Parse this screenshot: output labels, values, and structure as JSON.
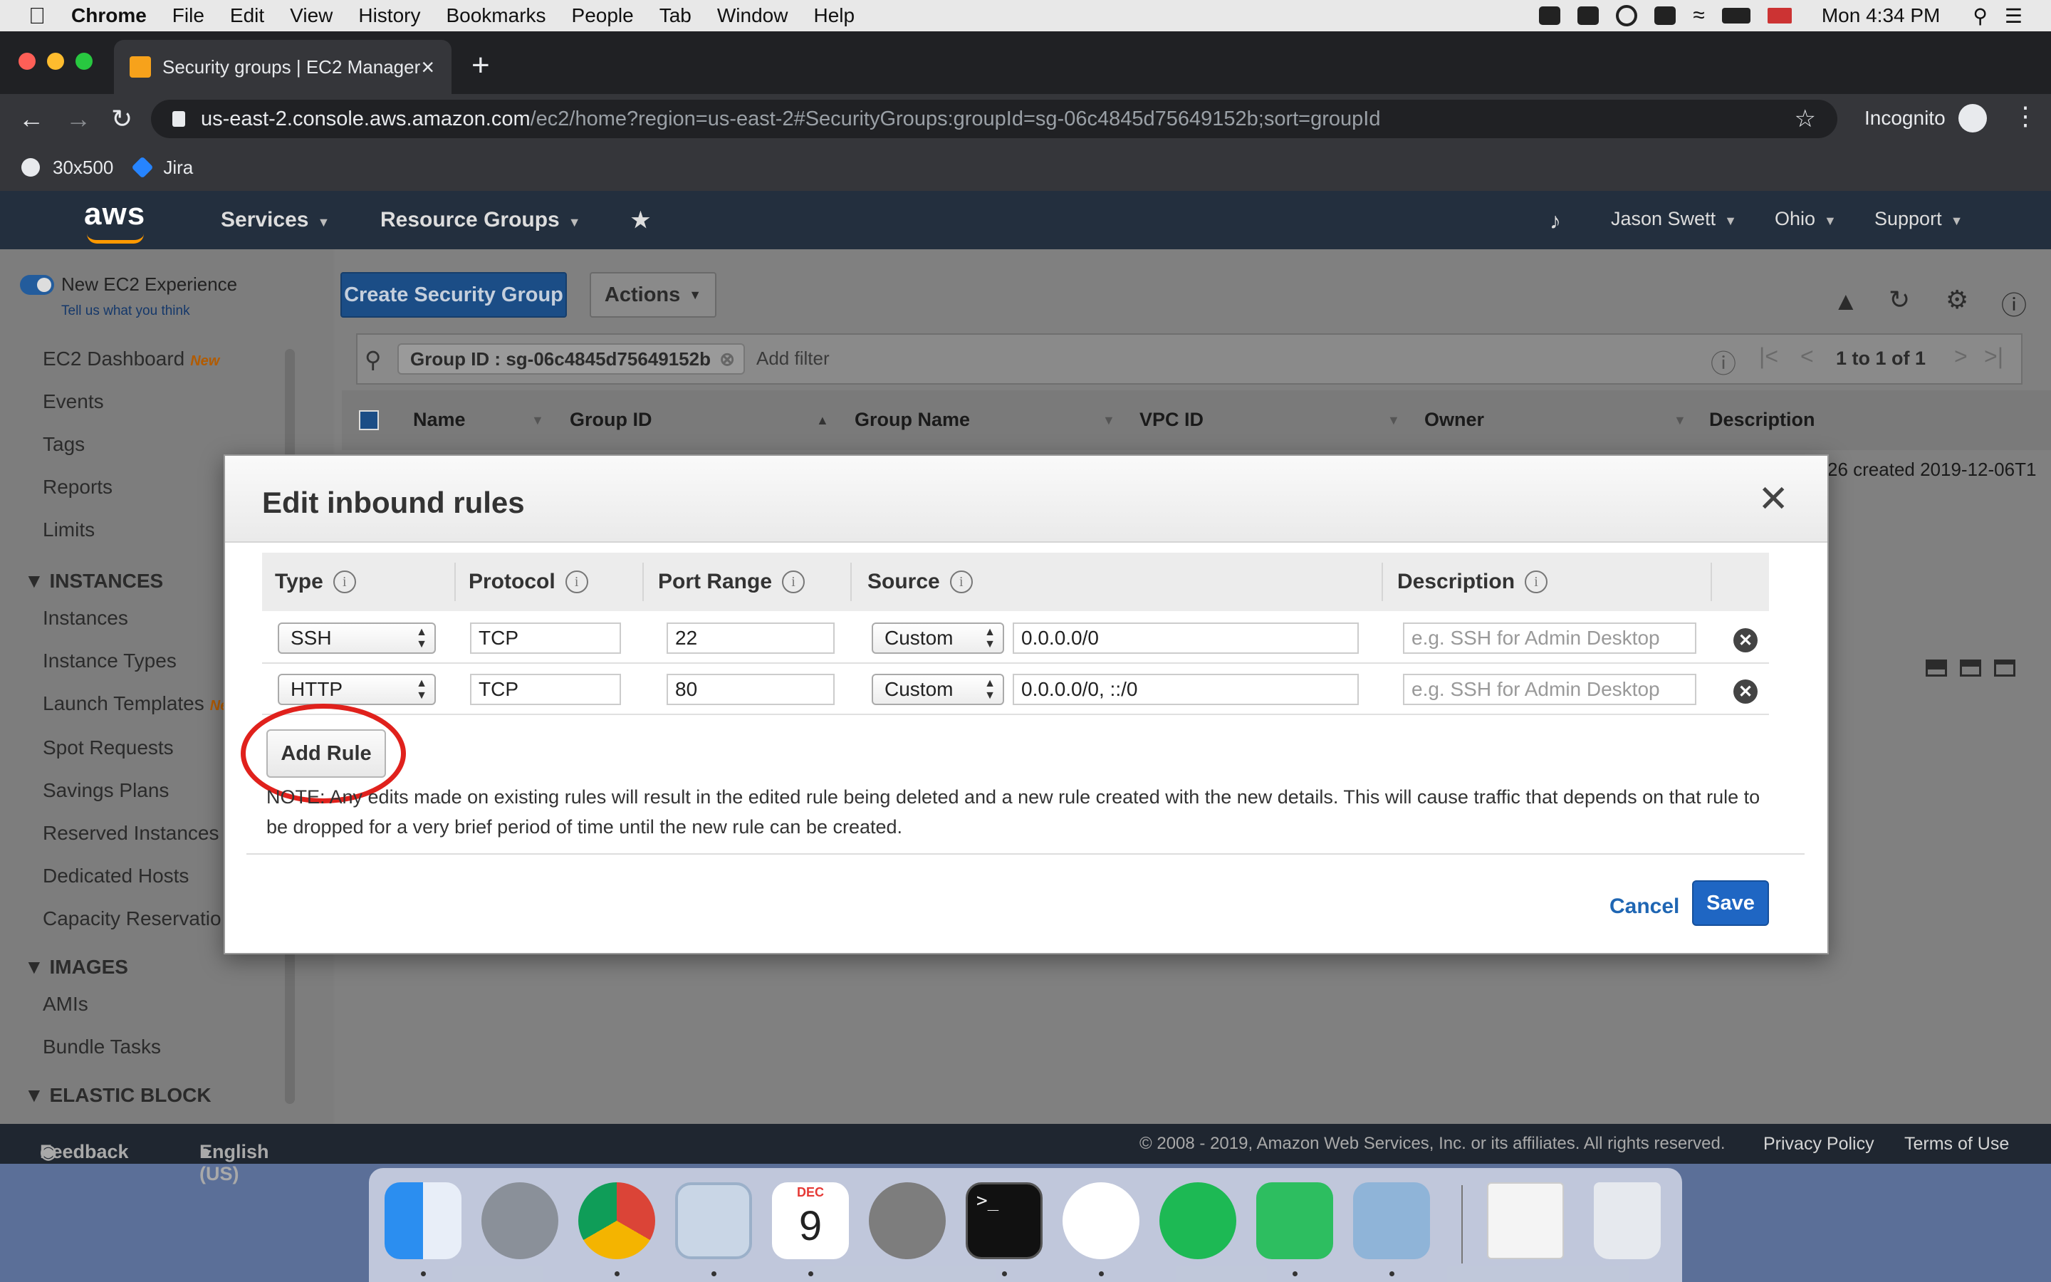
{
  "menubar": {
    "app": "Chrome",
    "items": [
      "File",
      "Edit",
      "View",
      "History",
      "Bookmarks",
      "People",
      "Tab",
      "Window",
      "Help"
    ],
    "clock": "Mon 4:34 PM"
  },
  "browser": {
    "tab_title": "Security groups | EC2 Manager",
    "url_host": "us-east-2.console.aws.amazon.com",
    "url_path": "/ec2/home?region=us-east-2#SecurityGroups:groupId=sg-06c4845d75649152b;sort=groupId",
    "incognito_label": "Incognito",
    "bookmarks": [
      "30x500",
      "Jira"
    ]
  },
  "aws_nav": {
    "logo": "aws",
    "services": "Services",
    "resource_groups": "Resource Groups",
    "user": "Jason Swett",
    "region": "Ohio",
    "support": "Support"
  },
  "sidebar": {
    "new_experience": "New EC2 Experience",
    "feedback_link": "Tell us what you think",
    "new_badge": "New",
    "new_badge_short": "Ne",
    "items_top": [
      "EC2 Dashboard",
      "Events",
      "Tags",
      "Reports",
      "Limits"
    ],
    "section_instances": "INSTANCES",
    "items_instances": [
      "Instances",
      "Instance Types",
      "Launch Templates",
      "Spot Requests",
      "Savings Plans",
      "Reserved Instances",
      "Dedicated Hosts",
      "Capacity Reservatio"
    ],
    "section_images": "IMAGES",
    "items_images": [
      "AMIs",
      "Bundle Tasks"
    ],
    "section_ebs": "ELASTIC BLOCK"
  },
  "console": {
    "create_button": "Create Security Group",
    "actions_button": "Actions",
    "filter_token": "Group ID : sg-06c4845d75649152b",
    "filter_placeholder": "Add filter",
    "pagination": "1 to 1 of 1",
    "columns": [
      "Name",
      "Group ID",
      "Group Name",
      "VPC ID",
      "Owner",
      "Description"
    ],
    "row_tail": "26 created 2019-12-06T1"
  },
  "modal": {
    "title": "Edit inbound rules",
    "headers": {
      "type": "Type",
      "protocol": "Protocol",
      "port_range": "Port Range",
      "source": "Source",
      "description": "Description"
    },
    "rules": [
      {
        "type": "SSH",
        "protocol": "TCP",
        "port": "22",
        "source_mode": "Custom",
        "source": "0.0.0.0/0",
        "description_placeholder": "e.g. SSH for Admin Desktop"
      },
      {
        "type": "HTTP",
        "protocol": "TCP",
        "port": "80",
        "source_mode": "Custom",
        "source": "0.0.0.0/0, ::/0",
        "description_placeholder": "e.g. SSH for Admin Desktop"
      }
    ],
    "add_rule": "Add Rule",
    "note": "NOTE: Any edits made on existing rules will result in the edited rule being deleted and a new rule created with the new details. This will cause traffic that depends on that rule to be dropped for a very brief period of time until the new rule can be created.",
    "cancel": "Cancel",
    "save": "Save"
  },
  "footer": {
    "feedback": "Feedback",
    "language": "English (US)",
    "copyright": "© 2008 - 2019, Amazon Web Services, Inc. or its affiliates. All rights reserved.",
    "privacy": "Privacy Policy",
    "terms": "Terms of Use"
  },
  "dock": {
    "apps": [
      "finder-icon",
      "launchpad-icon",
      "chrome-icon",
      "mail-icon",
      "calendar-icon",
      "system-preferences-icon",
      "terminal-icon",
      "slack-icon",
      "spotify-icon",
      "evernote-icon",
      "preview-icon",
      "chrome-window-icon",
      "trash-icon"
    ],
    "calendar_month": "DEC",
    "calendar_day": "9",
    "terminal_prompt": ">_"
  },
  "colors": {
    "aws_nav": "#232f3e",
    "aws_orange": "#ff9900",
    "primary_blue": "#1f66c3",
    "highlight_red": "#e0211c"
  }
}
